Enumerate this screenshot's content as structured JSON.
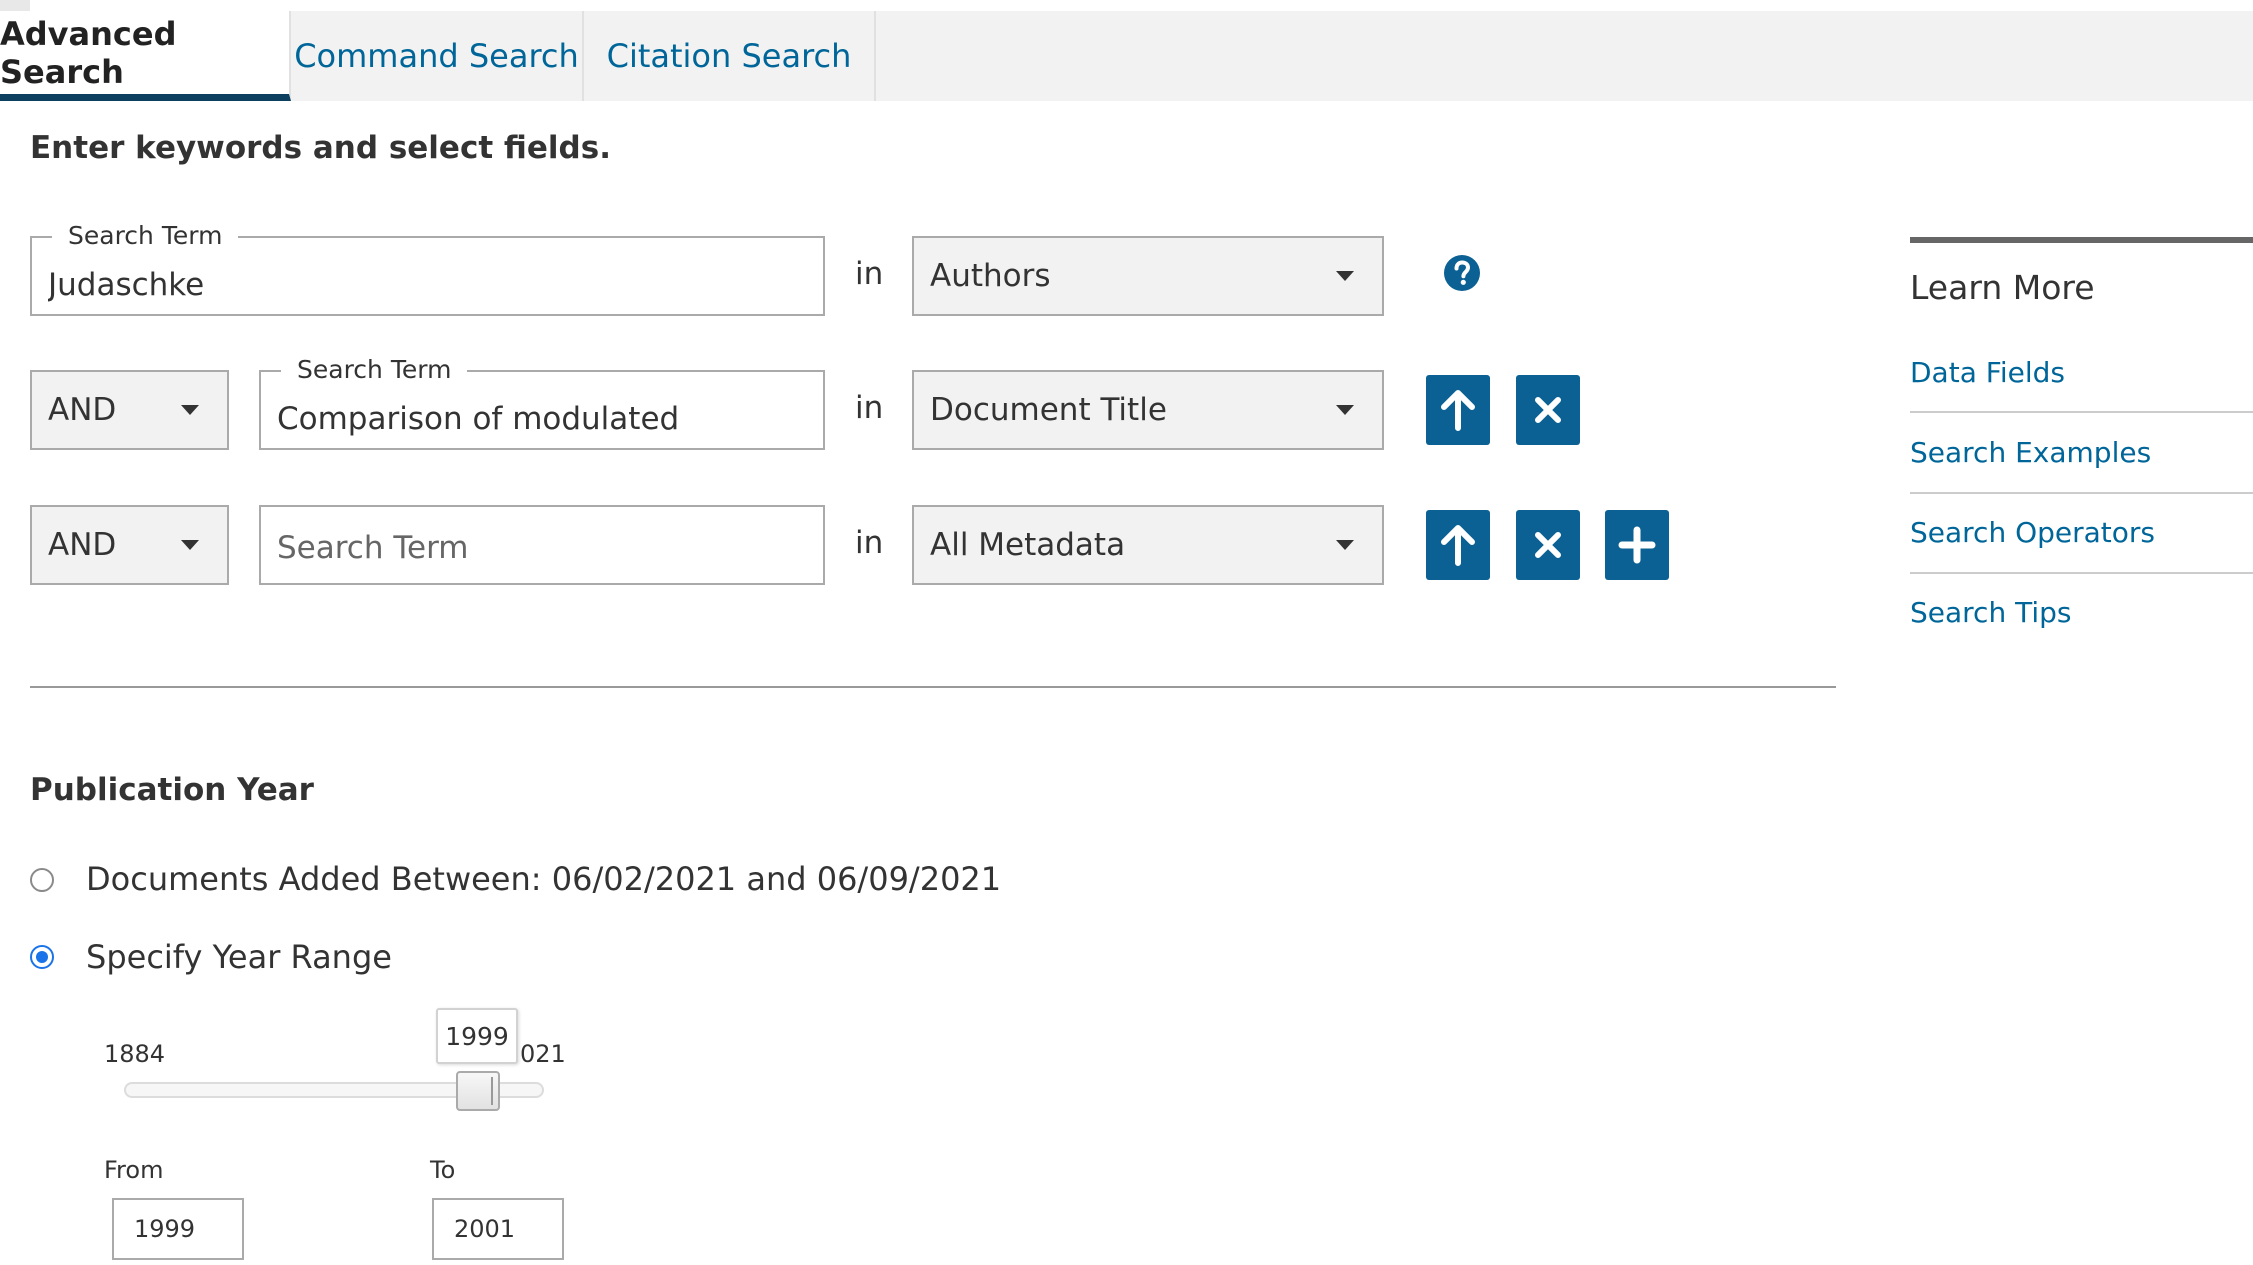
{
  "tabs": [
    {
      "label": "Advanced Search",
      "active": true
    },
    {
      "label": "Command Search",
      "active": false
    },
    {
      "label": "Citation Search",
      "active": false
    }
  ],
  "heading": "Enter keywords and select fields.",
  "rows": [
    {
      "operator": "",
      "legend": "Search Term",
      "value": "Judaschke",
      "placeholder": "",
      "in_label": "in",
      "field": "Authors"
    },
    {
      "operator": "AND",
      "legend": "Search Term",
      "value": "Comparison of modulated",
      "placeholder": "",
      "in_label": "in",
      "field": "Document Title"
    },
    {
      "operator": "AND",
      "legend": "",
      "value": "",
      "placeholder": "Search Term",
      "in_label": "in",
      "field": "All Metadata"
    }
  ],
  "icons": {
    "help": "question-circle-icon",
    "up": "arrow-up-icon",
    "remove": "close-icon",
    "add": "plus-icon"
  },
  "publication": {
    "heading": "Publication Year",
    "option_added": "Documents Added Between: 06/02/2021 and 06/09/2021",
    "option_range": "Specify Year Range",
    "selected": "range",
    "slider": {
      "min_label": "1884",
      "max_label": "021",
      "min": 1884,
      "max": 2021,
      "value": 1999,
      "tooltip": "1999"
    },
    "from_label": "From",
    "from_value": "1999",
    "to_label": "To",
    "to_value": "2001"
  },
  "learn_more": {
    "title": "Learn More",
    "links": [
      "Data Fields",
      "Search Examples",
      "Search Operators",
      "Search Tips"
    ]
  },
  "colors": {
    "accent": "#0b6193",
    "link": "#006699",
    "tab_underline": "#0d3f5e",
    "radio": "#1a73e8"
  }
}
